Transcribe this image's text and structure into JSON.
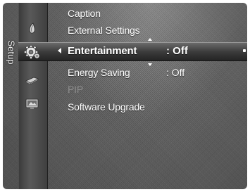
{
  "menu": {
    "category_title": "Setup",
    "items": [
      {
        "label": "Caption",
        "value": "",
        "state": "normal"
      },
      {
        "label": "External Settings",
        "value": "",
        "state": "normal"
      },
      {
        "label": "Entertainment",
        "value": ": Off",
        "state": "selected"
      },
      {
        "label": "Energy Saving",
        "value": ": Off",
        "state": "normal"
      },
      {
        "label": "PIP",
        "value": "",
        "state": "disabled"
      },
      {
        "label": "Software Upgrade",
        "value": "",
        "state": "normal"
      }
    ]
  },
  "category_icons": [
    "picture-icon",
    "setup-gear-icon",
    "input-icon",
    "support-icon"
  ]
}
